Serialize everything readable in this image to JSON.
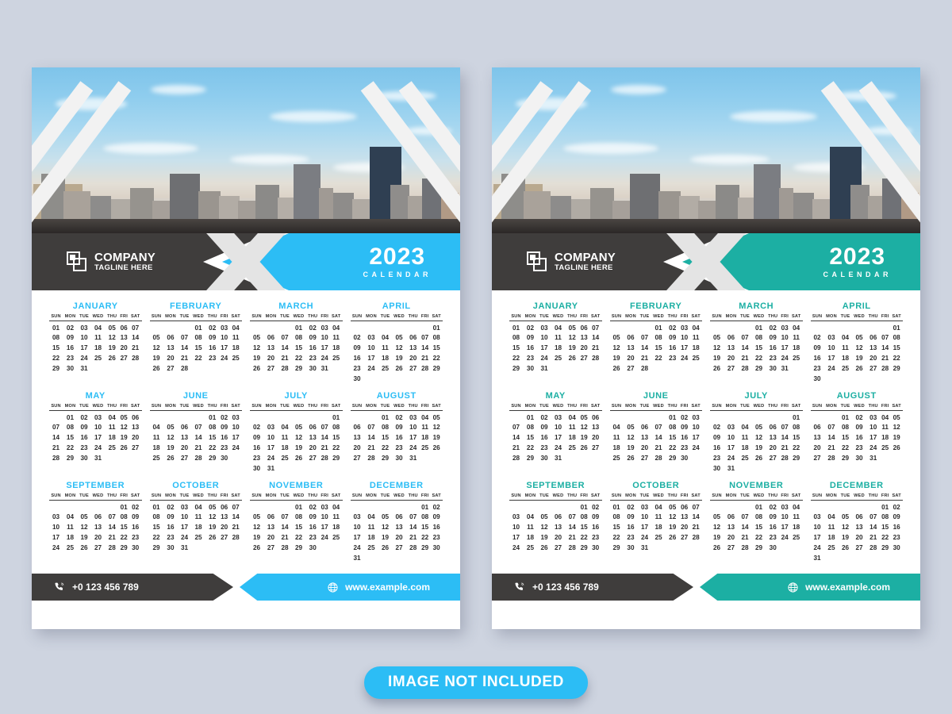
{
  "page": {
    "background_color": "#ced4e0",
    "badge_label": "IMAGE NOT INCLUDED",
    "badge_color": "#2cbdf5"
  },
  "weekdays": [
    "SUN",
    "MON",
    "TUE",
    "WED",
    "THU",
    "FRI",
    "SAT"
  ],
  "brand": {
    "name": "COMPANY",
    "tagline": "TAGLINE HERE",
    "logo_icon": "overlapping-squares-icon"
  },
  "year_block": {
    "year": "2023",
    "word": "CALENDAR"
  },
  "footer": {
    "phone": "+0 123 456 789",
    "phone_icon": "phone-icon",
    "website": "www.example.com",
    "website_icon": "globe-icon"
  },
  "variants": [
    {
      "id": "left",
      "accent": "#2cbdf5",
      "dark": "#3f3d3c"
    },
    {
      "id": "right",
      "accent": "#1cafa3",
      "dark": "#3f3d3c"
    }
  ],
  "months": [
    {
      "name": "JANUARY",
      "start": 0,
      "days": 31
    },
    {
      "name": "FEBRUARY",
      "start": 3,
      "days": 28
    },
    {
      "name": "MARCH",
      "start": 3,
      "days": 31
    },
    {
      "name": "APRIL",
      "start": 6,
      "days": 30
    },
    {
      "name": "MAY",
      "start": 1,
      "days": 31
    },
    {
      "name": "JUNE",
      "start": 4,
      "days": 30
    },
    {
      "name": "JULY",
      "start": 6,
      "days": 31
    },
    {
      "name": "AUGUST",
      "start": 2,
      "days": 31
    },
    {
      "name": "SEPTEMBER",
      "start": 5,
      "days": 30
    },
    {
      "name": "OCTOBER",
      "start": 0,
      "days": 31
    },
    {
      "name": "NOVEMBER",
      "start": 3,
      "days": 30
    },
    {
      "name": "DECEMBER",
      "start": 5,
      "days": 31
    }
  ]
}
